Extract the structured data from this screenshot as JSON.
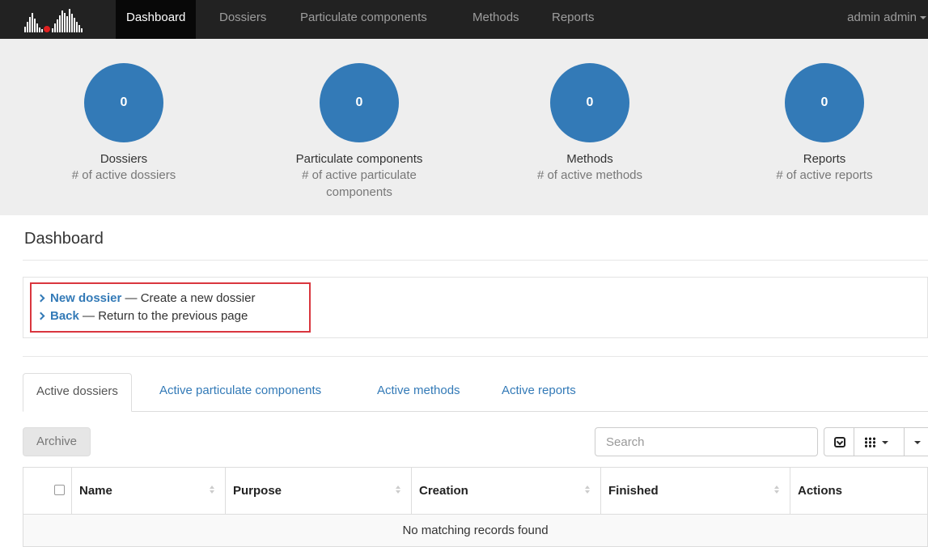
{
  "navbar": {
    "items": [
      {
        "label": "Dashboard",
        "active": true
      },
      {
        "label": "Dossiers",
        "active": false
      },
      {
        "label": "Particulate components",
        "active": false
      },
      {
        "label": "Methods",
        "active": false
      },
      {
        "label": "Reports",
        "active": false
      }
    ],
    "user": "admin admin"
  },
  "stats": [
    {
      "count": "0",
      "title": "Dossiers",
      "subtitle": "# of active dossiers"
    },
    {
      "count": "0",
      "title": "Particulate components",
      "subtitle": "# of active particulate components"
    },
    {
      "count": "0",
      "title": "Methods",
      "subtitle": "# of active methods"
    },
    {
      "count": "0",
      "title": "Reports",
      "subtitle": "# of active reports"
    }
  ],
  "page": {
    "title": "Dashboard"
  },
  "actions": [
    {
      "link": "New dossier",
      "description": " — Create a new dossier"
    },
    {
      "link": "Back",
      "description": " — Return to the previous page"
    }
  ],
  "tabs": [
    {
      "label": "Active dossiers",
      "active": true
    },
    {
      "label": "Active particulate components",
      "active": false
    },
    {
      "label": "Active methods",
      "active": false
    },
    {
      "label": "Active reports",
      "active": false
    }
  ],
  "toolbar": {
    "archive_label": "Archive",
    "search_placeholder": "Search",
    "icons": [
      "toggle-view-icon",
      "columns-grid-icon",
      "export-caret-icon"
    ]
  },
  "table": {
    "columns": [
      "Name",
      "Purpose",
      "Creation",
      "Finished",
      "Actions"
    ],
    "empty_message": "No matching records found"
  },
  "colors": {
    "navbar": "#222222",
    "accent": "#337ab7",
    "highlight_border": "#d9363e",
    "stats_background": "#eeeeee"
  }
}
